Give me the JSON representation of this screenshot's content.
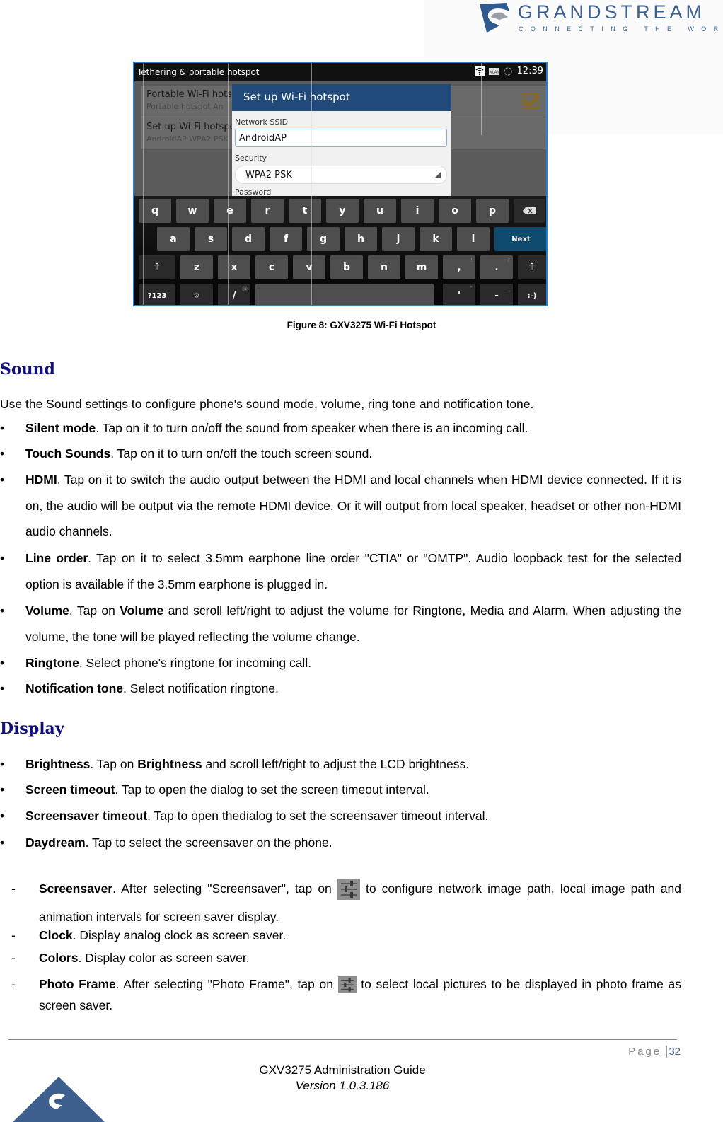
{
  "header": {
    "brand": "GRANDSTREAM",
    "tagline": "CONNECTING THE WORLD",
    "brand_color": "#3d5f8e"
  },
  "figure": {
    "caption": "Figure 8: GXV3275 Wi-Fi Hotspot",
    "screen": {
      "status_title": "Tethering & portable hotspot",
      "status_icons": [
        "wifi-icon",
        "vlan-icon",
        "sync-icon"
      ],
      "clock": "12:39",
      "background_items": [
        {
          "title": "Portable Wi-Fi hots",
          "subtitle": "Portable hotspot An",
          "checked": true
        },
        {
          "title": "Set up Wi-Fi hotspo",
          "subtitle": "AndroidAP WPA2 PSK"
        }
      ],
      "dialog": {
        "title": "Set up Wi-Fi hotspot",
        "ssid_label": "Network SSID",
        "ssid_value": "AndroidAP",
        "security_label": "Security",
        "security_value": "WPA2 PSK",
        "password_label": "Password"
      },
      "keyboard": {
        "row1": [
          "q",
          "w",
          "e",
          "r",
          "t",
          "y",
          "u",
          "i",
          "o",
          "p"
        ],
        "row2": [
          "a",
          "s",
          "d",
          "f",
          "g",
          "h",
          "j",
          "k",
          "l"
        ],
        "row3": [
          "z",
          "x",
          "c",
          "v",
          "b",
          "n",
          "m",
          ",",
          "."
        ],
        "row3_hints": {
          ",": "!",
          ".": "?"
        },
        "next_label": "Next",
        "symbols_label": "?123",
        "slash_label": "/",
        "slash_hint": "@",
        "apostrophe_label": "'",
        "apostrophe_hint": "\"",
        "dash_label": "-",
        "dash_hint": "_",
        "smiley_label": ":-)"
      }
    }
  },
  "sound": {
    "heading": "Sound",
    "intro": "Use the Sound settings to configure phone's sound mode, volume, ring tone and notification tone.",
    "items": [
      {
        "term": "Silent mode",
        "text": ". Tap on it to turn on/off the sound from speaker when there is an incoming call."
      },
      {
        "term": "Touch Sounds",
        "text": ". Tap on it to turn on/off the touch screen sound."
      },
      {
        "term": "HDMI",
        "text": ". Tap on it to switch the audio output between the HDMI and local channels when HDMI device connected. If it is on, the audio will be output via the remote HDMI device. Or it will output from local speaker, headset or other non-HDMI audio channels."
      },
      {
        "term": "Line order",
        "text": ". Tap on it to select 3.5mm earphone line order \"CTIA\" or \"OMTP\". Audio loopback test for the selected option is available if the 3.5mm earphone is plugged in."
      },
      {
        "term": "Volume",
        "text_a": ". Tap on ",
        "term2": "Volume",
        "text_b": " and scroll left/right to adjust the volume for Ringtone, Media and Alarm. When adjusting the volume, the tone will be played reflecting the volume change."
      },
      {
        "term": "Ringtone",
        "text": ". Select phone's ringtone for incoming call."
      },
      {
        "term": "Notification tone",
        "text": ". Select notification ringtone."
      }
    ]
  },
  "display": {
    "heading": "Display",
    "items": [
      {
        "term": "Brightness",
        "text_a": ". Tap on ",
        "term2": "Brightness",
        "text_b": " and scroll left/right to adjust the LCD brightness."
      },
      {
        "term": "Screen timeout",
        "text": ". Tap to open the dialog to set the screen timeout interval."
      },
      {
        "term": "Screensaver timeout",
        "text": ". Tap to open thedialog to set the screensaver timeout interval."
      },
      {
        "term": "Daydream",
        "text": ". Tap to select the screensaver on the phone."
      }
    ],
    "subitems": [
      {
        "term": "Screensaver",
        "text_a": ". After selecting \"Screensaver\", tap on ",
        "icon": "sliders-icon",
        "text_b": " to configure network image path, local image path and animation intervals for screen saver display."
      },
      {
        "term": "Clock",
        "text": ". Display analog clock as screen saver."
      },
      {
        "term": "Colors",
        "text": ". Display color as screen saver."
      },
      {
        "term": "Photo Frame",
        "text_a": ". After selecting \"Photo Frame\", tap on ",
        "icon": "sliders-icon",
        "text_b": " to select local pictures to be displayed in photo frame as screen saver."
      }
    ]
  },
  "footer": {
    "page_label": "Page",
    "page_number": "32",
    "title": "GXV3275 Administration Guide",
    "version": "Version 1.0.3.186"
  }
}
